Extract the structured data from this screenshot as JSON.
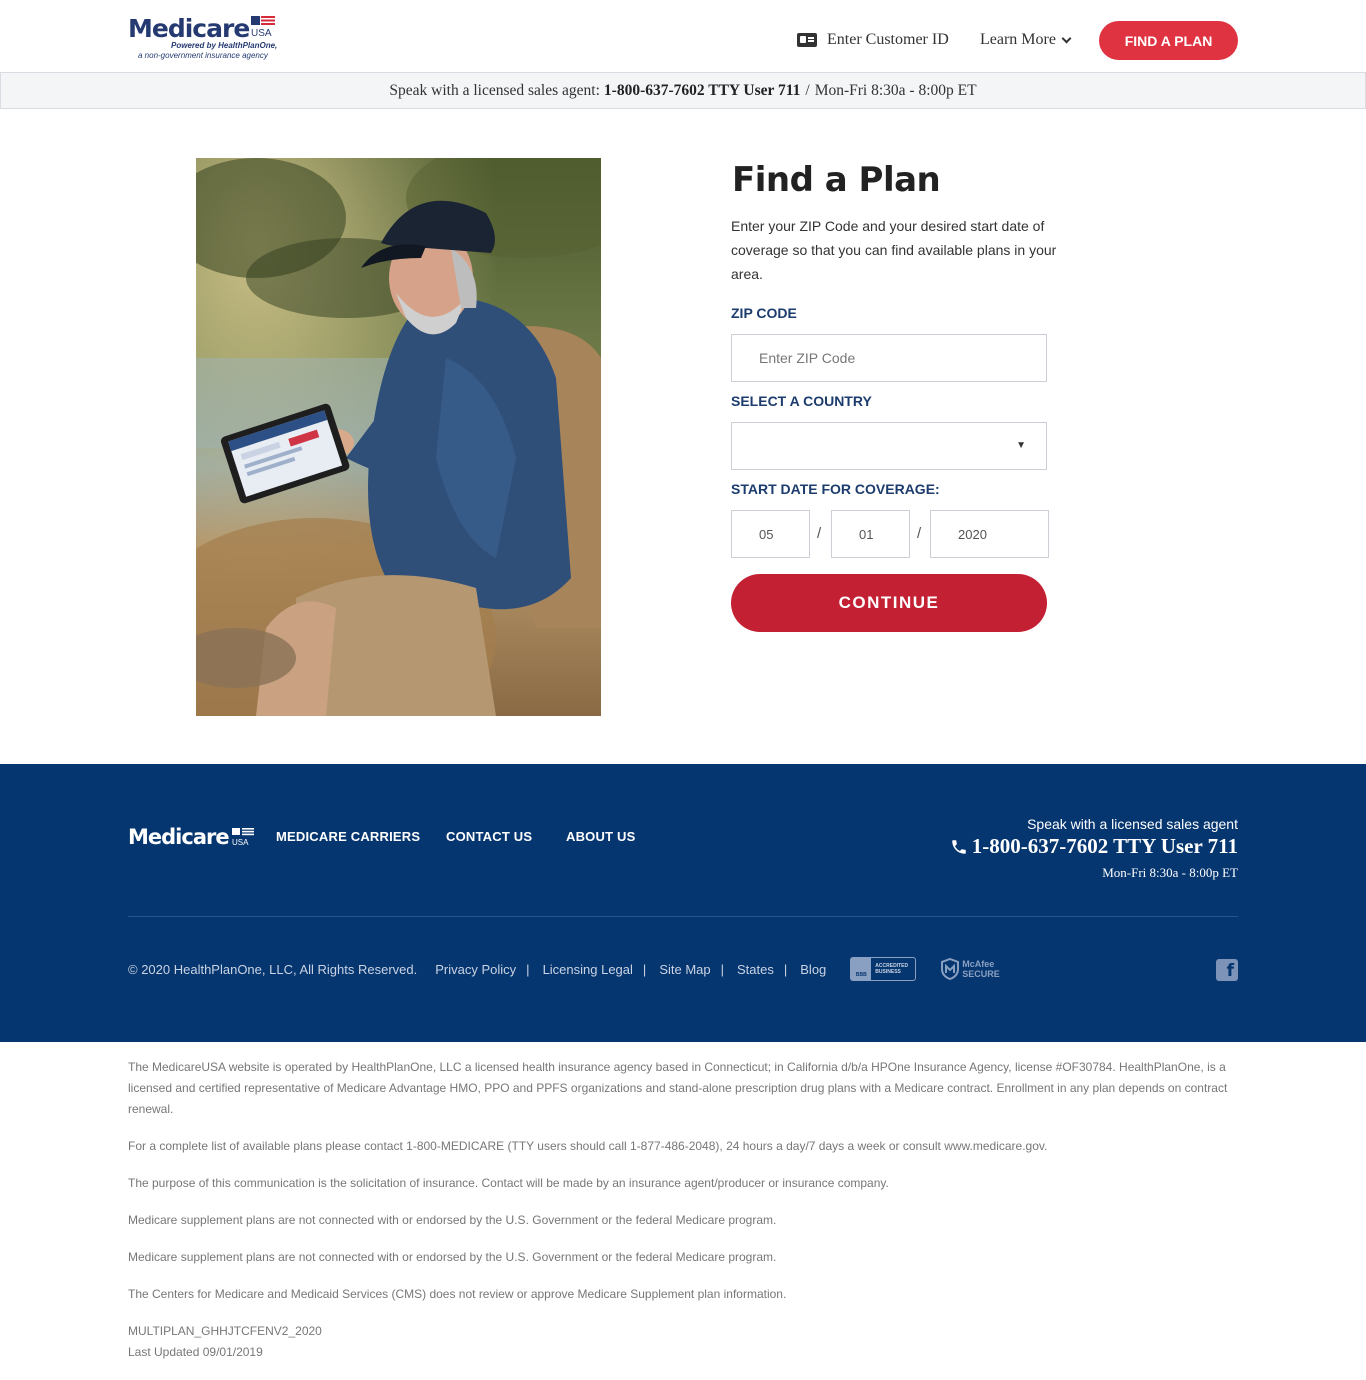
{
  "header": {
    "logo": {
      "word": "Medicare",
      "usa": "USA",
      "powered": "Powered by HealthPlanOne,",
      "nongov": "a non-government insurance agency"
    },
    "customer_id_label": "Enter Customer ID",
    "learn_more_label": "Learn More",
    "find_plan_label": "FIND A PLAN"
  },
  "agent_bar": {
    "prefix": "Speak with a licensed sales agent:",
    "phone": "1-800-637-7602 TTY User 711",
    "separator": "/",
    "hours": "Mon-Fri 8:30a - 8:00p ET"
  },
  "form": {
    "title": "Find a Plan",
    "description": "Enter your ZIP Code and your desired start date of coverage so that you can find available plans in your area.",
    "zip_label": "ZIP CODE",
    "zip_placeholder": "Enter ZIP Code",
    "zip_value": "",
    "country_label": "SELECT A COUNTRY",
    "country_value": "",
    "date_label": "START DATE FOR COVERAGE:",
    "date_month": "05",
    "date_day": "01",
    "date_year": "2020",
    "date_sep": "/",
    "continue_label": "CONTINUE"
  },
  "footer": {
    "logo_word": "Medicare",
    "logo_usa": "USA",
    "links": [
      "MEDICARE CARRIERS",
      "CONTACT US",
      "ABOUT US"
    ],
    "speak": "Speak with a licensed sales agent",
    "phone": "1-800-637-7602 TTY User 711",
    "hours": "Mon-Fri 8:30a - 8:00p ET",
    "copyright": "© 2020 HealthPlanOne, LLC, All Rights Reserved.",
    "bottom_links": [
      "Privacy Policy",
      "Licensing Legal",
      "Site Map",
      "States",
      "Blog"
    ],
    "pipe": "|",
    "bbb": {
      "left": "BBB",
      "right_1": "ACCREDITED",
      "right_2": "BUSINESS"
    },
    "mcafee": {
      "line1": "McAfee",
      "line2": "SECURE"
    },
    "facebook": "f"
  },
  "disclaimer": [
    "The MedicareUSA website is operated by HealthPlanOne, LLC a licensed health insurance agency based in Connecticut; in California d/b/a HPOne Insurance Agency, license #OF30784. HealthPlanOne, is a licensed and certified representative of Medicare Advantage HMO, PPO and PPFS organizations and stand-alone prescription drug plans with a Medicare contract. Enrollment in any plan depends on contract renewal.",
    "For a complete list of available plans please contact 1-800-MEDICARE (TTY users should call 1-877-486-2048), 24 hours a day/7 days a week or consult www.medicare.gov.",
    "The purpose of this communication is the solicitation of insurance. Contact will be made by an insurance agent/producer or insurance company.",
    "Medicare supplement plans are not connected with or endorsed by the U.S. Government or the federal Medicare program.",
    "Medicare supplement plans are not connected with or endorsed by the U.S. Government or the federal Medicare program.",
    "The Centers for Medicare and Medicaid Services (CMS) does not review or approve Medicare Supplement plan information.",
    "MULTIPLAN_GHHJTCFENV2_2020",
    "Last Updated 09/01/2019"
  ],
  "colors": {
    "brand_navy": "#063670",
    "logo_navy": "#263a72",
    "accent_red": "#e03342",
    "continue_red": "#c42033",
    "label_blue": "#1d3c6e"
  },
  "icons": [
    "id-card-icon",
    "chevron-down-icon",
    "phone-icon",
    "facebook-icon",
    "mcafee-shield-icon",
    "bbb-logo-icon",
    "flag-icon"
  ]
}
